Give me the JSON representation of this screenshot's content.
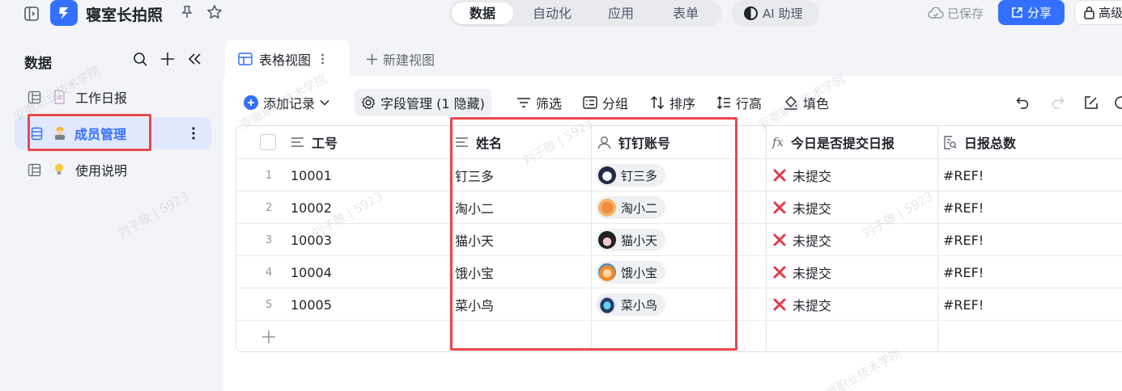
{
  "app": {
    "title": "寝室长拍照",
    "saved_status": "已保存",
    "share_label": "分享",
    "advanced_label": "高级"
  },
  "top_tabs": [
    "数据",
    "自动化",
    "应用",
    "表单"
  ],
  "ai_assistant_label": "AI 助理",
  "sidebar": {
    "header": "数据",
    "items": [
      {
        "label": "工作日报",
        "icon": "document-icon"
      },
      {
        "label": "成员管理",
        "icon": "worker-emoji-icon"
      },
      {
        "label": "使用说明",
        "icon": "lightbulb-icon"
      }
    ]
  },
  "view_tabs": {
    "active": "表格视图",
    "new_view": "新建视图"
  },
  "toolbar": {
    "add_record": "添加记录",
    "field_manage": "字段管理 (1 隐藏)",
    "filter": "筛选",
    "group": "分组",
    "sort": "排序",
    "row_height": "行高",
    "fill_color": "填色"
  },
  "table": {
    "columns": [
      "工号",
      "姓名",
      "钉钉账号",
      "今日是否提交日报",
      "日报总数"
    ],
    "rows": [
      {
        "index": "1",
        "id": "10001",
        "name": "钉三多",
        "account": "钉三多",
        "submitted": "未提交",
        "total": "#REF!"
      },
      {
        "index": "2",
        "id": "10002",
        "name": "淘小二",
        "account": "淘小二",
        "submitted": "未提交",
        "total": "#REF!"
      },
      {
        "index": "3",
        "id": "10003",
        "name": "猫小天",
        "account": "猫小天",
        "submitted": "未提交",
        "total": "#REF!"
      },
      {
        "index": "4",
        "id": "10004",
        "name": "饿小宝",
        "account": "饿小宝",
        "submitted": "未提交",
        "total": "#REF!"
      },
      {
        "index": "5",
        "id": "10005",
        "name": "菜小鸟",
        "account": "菜小鸟",
        "submitted": "未提交",
        "total": "#REF!"
      }
    ]
  },
  "watermark": {
    "lines": [
      "刘子敬 | 5923",
      "安徽职业技术学院"
    ]
  },
  "colors": {
    "accent": "#3370ff",
    "highlight_box": "#e9484c",
    "not_submitted": "#e63946"
  }
}
